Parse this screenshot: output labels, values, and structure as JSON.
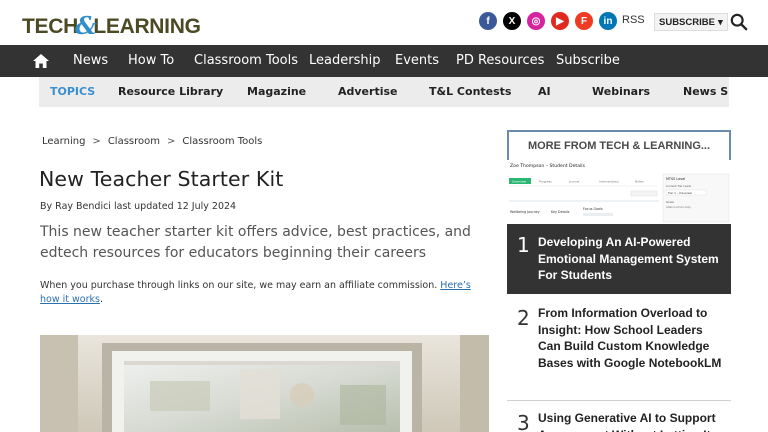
{
  "header": {
    "logo_left": "TECH",
    "logo_amp": "&",
    "logo_right": "LEARNING",
    "socials": [
      {
        "name": "facebook",
        "glyph": "f",
        "color": "#3b5998"
      },
      {
        "name": "x",
        "glyph": "X",
        "color": "#000000"
      },
      {
        "name": "instagram",
        "glyph": "◎",
        "color": "#d6249f"
      },
      {
        "name": "youtube",
        "glyph": "▶",
        "color": "#e02a20"
      },
      {
        "name": "flipboard",
        "glyph": "F",
        "color": "#ef3b24"
      },
      {
        "name": "linkedin",
        "glyph": "in",
        "color": "#0077b5"
      }
    ],
    "rss_label": "RSS",
    "subscribe_label": "SUBSCRIBE",
    "subscribe_caret": "▾"
  },
  "nav": {
    "items": [
      "News",
      "How To",
      "Classroom Tools",
      "Leadership",
      "Events",
      "PD Resources",
      "Subscribe"
    ]
  },
  "topics": {
    "label": "TOPICS",
    "items": [
      "Resource Library",
      "Magazine",
      "Advertise",
      "T&L Contests",
      "AI",
      "Webinars",
      "News Sig"
    ]
  },
  "article": {
    "breadcrumb": [
      "Learning",
      "Classroom",
      "Classroom Tools"
    ],
    "breadcrumb_sep": ">",
    "title": "New Teacher Starter Kit",
    "byline_prefix": "By",
    "author": "Ray Bendici",
    "updated_label": "last updated",
    "date": "12 July 2024",
    "standfirst": "This new teacher starter kit offers advice, best practices, and edtech resources for educators beginning their careers",
    "affiliate_text": "When you purchase through links on our site, we may earn an affiliate commission.",
    "affiliate_link": "Here’s how it works",
    "affiliate_end": "."
  },
  "sidebar": {
    "title": "MORE FROM TECH & LEARNING...",
    "thumb": {
      "heading": "Zoe Thompson – Student Details",
      "tabs": [
        "Overview",
        "Progress",
        "Journal",
        "Interventions",
        "Notes"
      ],
      "panel_title": "MTSS Level",
      "panel_lines": [
        "Current Tier Level",
        "Tier 1 - Universal",
        "Goals",
        "Attend school daily"
      ],
      "section_a": "Wellbeing Journey",
      "section_b": "Key Details",
      "section_c": "Focus Goals"
    },
    "items": [
      {
        "num": "1",
        "title": "Developing An AI-Powered Emotional Management System For Students"
      },
      {
        "num": "2",
        "title": "From Information Overload to Insight: How School Leaders Can Build Custom Knowledge Bases with Google NotebookLM"
      },
      {
        "num": "3",
        "title": "Using Generative AI to Support Assessment Without Letting It"
      }
    ]
  }
}
